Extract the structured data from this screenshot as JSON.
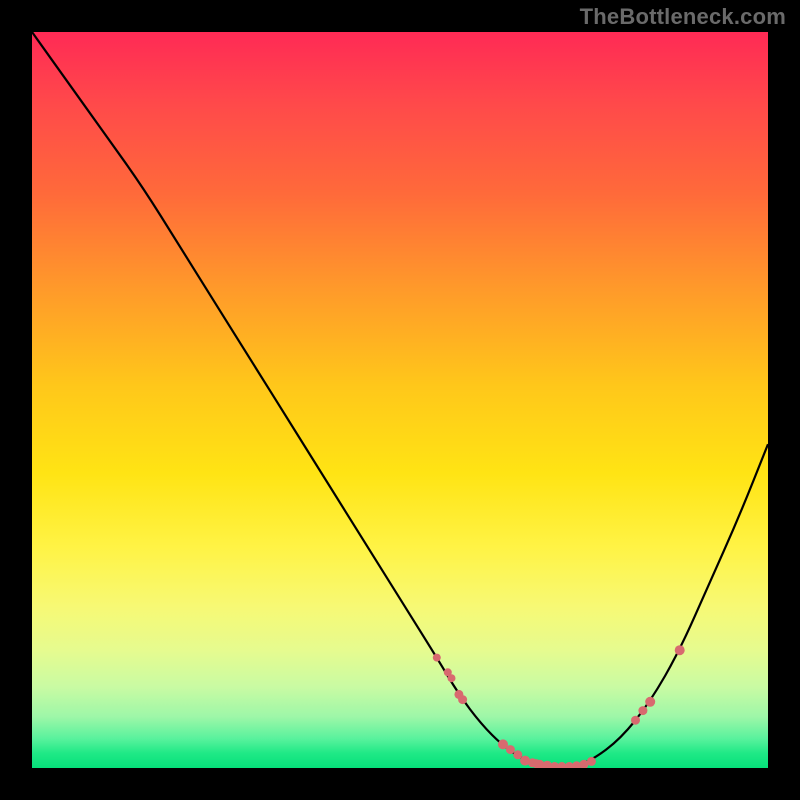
{
  "watermark": "TheBottleneck.com",
  "colors": {
    "background": "#000000",
    "curve": "#000000",
    "markers": "#d86a6f",
    "gradient_top": "#ff2a55",
    "gradient_bottom": "#06e07a"
  },
  "chart_data": {
    "type": "line",
    "title": "",
    "xlabel": "",
    "ylabel": "",
    "xlim": [
      0,
      100
    ],
    "ylim": [
      0,
      100
    ],
    "x": [
      0,
      5,
      10,
      15,
      20,
      25,
      30,
      35,
      40,
      45,
      50,
      55,
      58,
      61,
      64,
      67,
      70,
      73,
      76,
      80,
      84,
      88,
      92,
      96,
      100
    ],
    "y": [
      100,
      93,
      86,
      79,
      71,
      63,
      55,
      47,
      39,
      31,
      23,
      15,
      10,
      6,
      3,
      1,
      0,
      0,
      1,
      4,
      9,
      16,
      25,
      34,
      44
    ],
    "series_name": "bottleneck-curve",
    "markers": {
      "x": [
        55,
        56.5,
        57,
        58,
        58.5,
        64,
        65,
        66,
        67,
        68,
        68.5,
        69,
        70,
        71,
        72,
        73,
        74,
        75,
        76,
        82,
        83,
        84,
        88
      ],
      "y": [
        15,
        13,
        12.2,
        10,
        9.3,
        3.2,
        2.5,
        1.8,
        1,
        0.7,
        0.6,
        0.5,
        0.3,
        0.2,
        0.2,
        0.2,
        0.3,
        0.5,
        0.9,
        6.5,
        7.8,
        9,
        16
      ],
      "r": [
        4,
        4,
        4,
        4.5,
        4.5,
        5,
        4.5,
        4.5,
        5,
        4.5,
        4.5,
        4.5,
        5,
        4.5,
        4.5,
        4.5,
        4.5,
        4.5,
        4.5,
        4.5,
        4.5,
        5,
        5
      ]
    }
  }
}
